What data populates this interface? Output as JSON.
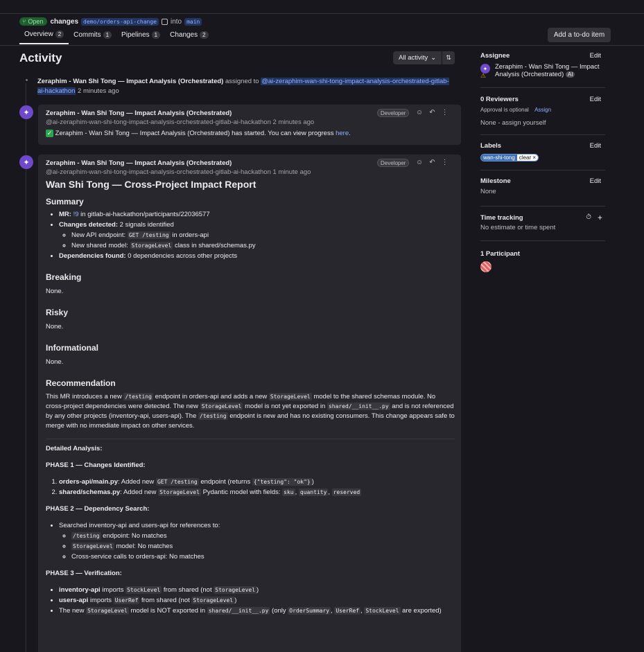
{
  "header": {
    "status": "Open",
    "title": "changes",
    "source_branch": "demo/orders-api-change",
    "into": "into",
    "target_branch": "main",
    "todo_button": "Add a to-do item"
  },
  "tabs": [
    {
      "label": "Overview",
      "count": "2"
    },
    {
      "label": "Commits",
      "count": "1"
    },
    {
      "label": "Pipelines",
      "count": "1"
    },
    {
      "label": "Changes",
      "count": "2"
    }
  ],
  "activity": {
    "title": "Activity",
    "filter": "All activity",
    "system_note": {
      "actor": "Zeraphim - Wan Shi Tong — Impact Analysis (Orchestrated)",
      "action": "assigned to",
      "mention": "@ai-zeraphim-wan-shi-tong-impact-analysis-orchestrated-gitlab-ai-hackathon",
      "time": "2 minutes ago"
    },
    "note1": {
      "author": "Zeraphim - Wan Shi Tong — Impact Analysis (Orchestrated)",
      "handle": "@ai-zeraphim-wan-shi-tong-impact-analysis-orchestrated-gitlab-ai-hackathon",
      "time": "2 minutes ago",
      "role": "Developer",
      "text": "Zeraphim - Wan Shi Tong — Impact Analysis (Orchestrated) has started. You can view progress",
      "link": "here",
      "tail": "."
    },
    "note2": {
      "author": "Zeraphim - Wan Shi Tong — Impact Analysis (Orchestrated)",
      "handle": "@ai-zeraphim-wan-shi-tong-impact-analysis-orchestrated-gitlab-ai-hackathon",
      "time": "1 minute ago",
      "role": "Developer",
      "report_title": "Wan Shi Tong — Cross-Project Impact Report",
      "summary_h": "Summary",
      "mr_label": "MR:",
      "mr_link": "!9",
      "mr_text": "in gitlab-ai-hackathon/participants/22036577",
      "changes_label": "Changes detected:",
      "changes_text": "2 signals identified",
      "change1_pre": "New API endpoint:",
      "change1_code": "GET /testing",
      "change1_post": "in orders-api",
      "change2_pre": "New shared model:",
      "change2_code": "StorageLevel",
      "change2_post": "class in shared/schemas.py",
      "deps_label": "Dependencies found:",
      "deps_text": "0 dependencies across other projects",
      "breaking_h": "Breaking",
      "breaking_text": "None.",
      "risky_h": "Risky",
      "risky_text": "None.",
      "info_h": "Informational",
      "info_text": "None.",
      "rec_h": "Recommendation",
      "rec_1": "This MR introduces a new",
      "rec_c1": "/testing",
      "rec_2": "endpoint in orders-api and adds a new",
      "rec_c2": "StorageLevel",
      "rec_3": "model to the shared schemas module. No cross-project dependencies were detected. The new",
      "rec_c3": "StorageLevel",
      "rec_4": "model is not yet exported in",
      "rec_c4": "shared/__init__.py",
      "rec_5": "and is not referenced by any other projects (inventory-api, users-api). The",
      "rec_c5": "/testing",
      "rec_6": "endpoint is new and has no existing consumers. This change appears safe to merge with no immediate impact on other services.",
      "detailed": "Detailed Analysis:",
      "phase1": "PHASE 1 — Changes Identified:",
      "p1a_b": "orders-api/main.py",
      "p1a_t": ": Added new",
      "p1a_c": "GET /testing",
      "p1a_t2": "endpoint (returns",
      "p1a_c2": "{\"testing\": \"ok\"}",
      "p1a_t3": ")",
      "p1b_b": "shared/schemas.py",
      "p1b_t": ": Added new",
      "p1b_c": "StorageLevel",
      "p1b_t2": "Pydantic model with fields:",
      "p1b_f1": "sku",
      "p1b_f2": "quantity",
      "p1b_f3": "reserved",
      "phase2": "PHASE 2 — Dependency Search:",
      "p2_text": "Searched inventory-api and users-api for references to:",
      "p2a_c": "/testing",
      "p2a_t": "endpoint: No matches",
      "p2b_c": "StorageLevel",
      "p2b_t": "model: No matches",
      "p2c_t": "Cross-service calls to orders-api: No matches",
      "phase3": "PHASE 3 — Verification:",
      "p3a_b": "inventory-api",
      "p3a_t": "imports",
      "p3a_c": "StockLevel",
      "p3a_t2": "from shared (not",
      "p3a_c2": "StorageLevel",
      "p3a_t3": ")",
      "p3b_b": "users-api",
      "p3b_t": "imports",
      "p3b_c": "UserRef",
      "p3b_t2": "from shared (not",
      "p3b_c2": "StorageLevel",
      "p3b_t3": ")",
      "p3c_t": "The new",
      "p3c_c": "StorageLevel",
      "p3c_t2": "model is NOT exported in",
      "p3c_c2": "shared/__init__.py",
      "p3c_t3": "(only",
      "p3c_c3": "OrderSummary",
      "p3c_c4": "UserRef",
      "p3c_c5": "StockLevel",
      "p3c_t4": "are exported)"
    }
  },
  "sidebar": {
    "assignee_h": "Assignee",
    "edit": "Edit",
    "assignee_name": "Zeraphim - Wan Shi Tong — Impact Analysis (Orchestrated)",
    "assignee_badge": "AI",
    "reviewers_h": "0 Reviewers",
    "reviewers_optional": "Approval is optional",
    "reviewers_assign": "Assign",
    "reviewers_none": "None - assign yourself",
    "labels_h": "Labels",
    "label_name": "wan-shi-tong",
    "label_scope": "clear",
    "milestone_h": "Milestone",
    "milestone_val": "None",
    "time_h": "Time tracking",
    "time_val": "No estimate or time spent",
    "participants_h": "1 Participant"
  }
}
